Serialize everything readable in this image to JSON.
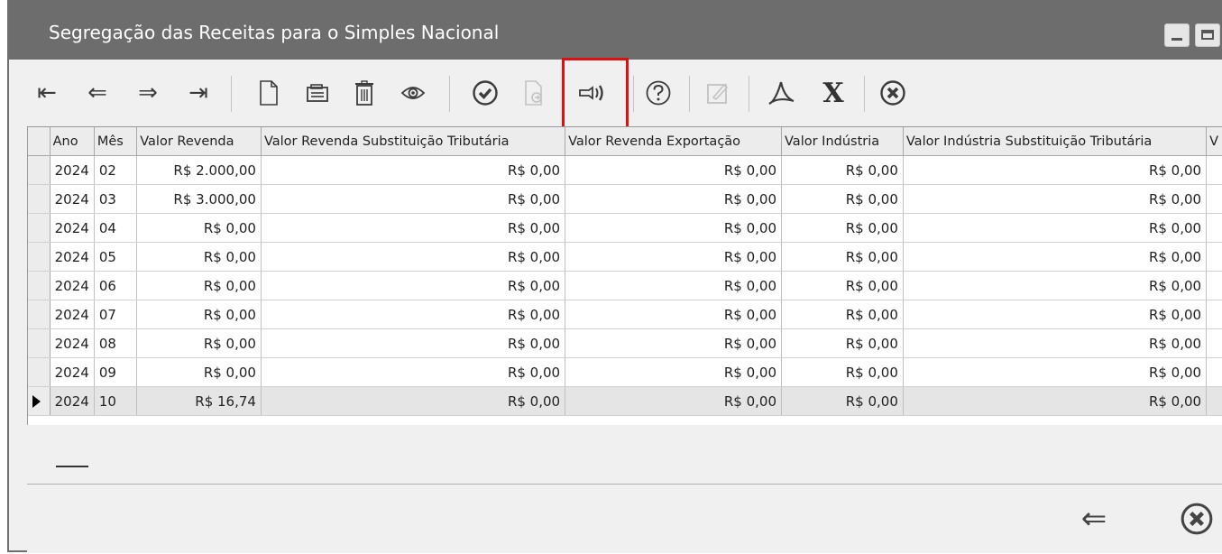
{
  "window": {
    "title": "Segregação das Receitas para o Simples Nacional"
  },
  "toolbar": {
    "buttons": [
      {
        "name": "first-record",
        "icon": "first-arrow-icon",
        "glyph": "⇤"
      },
      {
        "name": "previous-record",
        "icon": "left-arrow-icon",
        "glyph": "⇐"
      },
      {
        "name": "next-record",
        "icon": "right-arrow-icon",
        "glyph": "⇒"
      },
      {
        "name": "last-record",
        "icon": "last-arrow-icon",
        "glyph": "⇥"
      },
      {
        "name": "new",
        "icon": "new-document-icon"
      },
      {
        "name": "edit",
        "icon": "edit-folder-icon"
      },
      {
        "name": "delete",
        "icon": "trash-icon"
      },
      {
        "name": "view",
        "icon": "eye-icon"
      },
      {
        "name": "confirm",
        "icon": "check-circle-icon"
      },
      {
        "name": "export",
        "icon": "document-export-icon",
        "disabled": true
      },
      {
        "name": "signal",
        "icon": "signal-icon",
        "highlighted": true
      },
      {
        "name": "help",
        "icon": "question-circle-icon"
      },
      {
        "name": "edit-disabled",
        "icon": "pencil-box-icon",
        "disabled": true
      },
      {
        "name": "pdf",
        "icon": "pdf-icon"
      },
      {
        "name": "excel",
        "icon": "excel-x-icon",
        "glyph": "X"
      },
      {
        "name": "close",
        "icon": "close-circle-icon"
      }
    ]
  },
  "grid": {
    "columns": [
      "Ano",
      "Mês",
      "Valor Revenda",
      "Valor Revenda Substituição Tributária",
      "Valor Revenda Exportação",
      "Valor Indústria",
      "Valor Indústria Substituição Tributária",
      "V"
    ],
    "rows": [
      {
        "ano": "2024",
        "mes": "02",
        "v1": "R$ 2.000,00",
        "v2": "R$ 0,00",
        "v3": "R$ 0,00",
        "v4": "R$ 0,00",
        "v5": "R$ 0,00"
      },
      {
        "ano": "2024",
        "mes": "03",
        "v1": "R$ 3.000,00",
        "v2": "R$ 0,00",
        "v3": "R$ 0,00",
        "v4": "R$ 0,00",
        "v5": "R$ 0,00"
      },
      {
        "ano": "2024",
        "mes": "04",
        "v1": "R$ 0,00",
        "v2": "R$ 0,00",
        "v3": "R$ 0,00",
        "v4": "R$ 0,00",
        "v5": "R$ 0,00"
      },
      {
        "ano": "2024",
        "mes": "05",
        "v1": "R$ 0,00",
        "v2": "R$ 0,00",
        "v3": "R$ 0,00",
        "v4": "R$ 0,00",
        "v5": "R$ 0,00"
      },
      {
        "ano": "2024",
        "mes": "06",
        "v1": "R$ 0,00",
        "v2": "R$ 0,00",
        "v3": "R$ 0,00",
        "v4": "R$ 0,00",
        "v5": "R$ 0,00"
      },
      {
        "ano": "2024",
        "mes": "07",
        "v1": "R$ 0,00",
        "v2": "R$ 0,00",
        "v3": "R$ 0,00",
        "v4": "R$ 0,00",
        "v5": "R$ 0,00"
      },
      {
        "ano": "2024",
        "mes": "08",
        "v1": "R$ 0,00",
        "v2": "R$ 0,00",
        "v3": "R$ 0,00",
        "v4": "R$ 0,00",
        "v5": "R$ 0,00"
      },
      {
        "ano": "2024",
        "mes": "09",
        "v1": "R$ 0,00",
        "v2": "R$ 0,00",
        "v3": "R$ 0,00",
        "v4": "R$ 0,00",
        "v5": "R$ 0,00"
      },
      {
        "ano": "2024",
        "mes": "10",
        "v1": "R$ 16,74",
        "v2": "R$ 0,00",
        "v3": "R$ 0,00",
        "v4": "R$ 0,00",
        "v5": "R$ 0,00",
        "selected": true
      }
    ]
  },
  "bottom": {
    "back_icon": "left-arrow-icon",
    "back_glyph": "⇐",
    "close_icon": "close-circle-icon"
  },
  "colors": {
    "titlebar": "#6d6d6d",
    "highlight": "#e01010"
  }
}
